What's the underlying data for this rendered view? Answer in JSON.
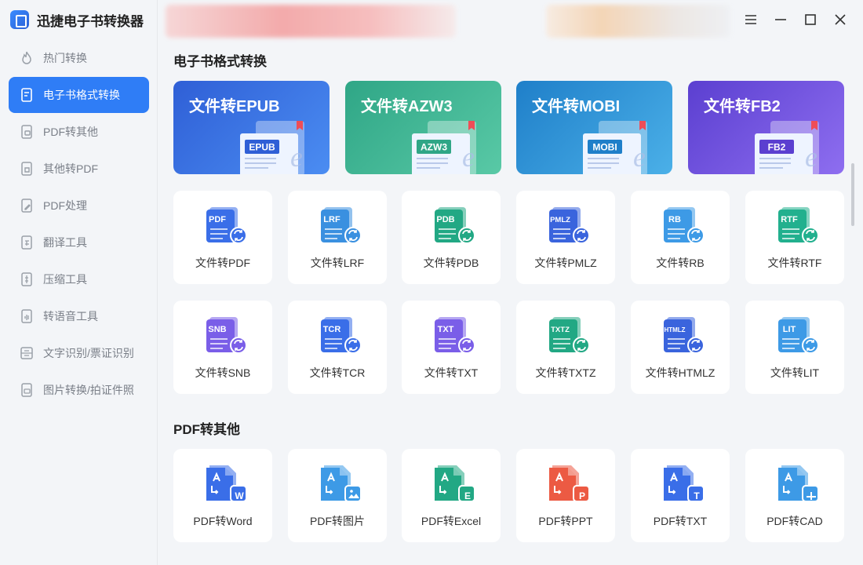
{
  "app": {
    "title": "迅捷电子书转换器"
  },
  "sidebar": {
    "items": [
      {
        "label": "热门转换",
        "icon": "flame-icon"
      },
      {
        "label": "电子书格式转换",
        "icon": "ebook-icon"
      },
      {
        "label": "PDF转其他",
        "icon": "pdf-convert-icon"
      },
      {
        "label": "其他转PDF",
        "icon": "to-pdf-icon"
      },
      {
        "label": "PDF处理",
        "icon": "pdf-edit-icon"
      },
      {
        "label": "翻译工具",
        "icon": "translate-icon"
      },
      {
        "label": "压缩工具",
        "icon": "compress-icon"
      },
      {
        "label": "转语音工具",
        "icon": "speech-icon"
      },
      {
        "label": "文字识别/票证识别",
        "icon": "ocr-icon"
      },
      {
        "label": "图片转换/拍证件照",
        "icon": "image-convert-icon"
      }
    ]
  },
  "window": {
    "menu_icon": "menu-icon",
    "minimize_icon": "minimize-icon",
    "maximize_icon": "maximize-icon",
    "close_icon": "close-icon"
  },
  "sections": {
    "ebook": {
      "title": "电子书格式转换",
      "heroes": [
        {
          "label": "文件转EPUB",
          "tag": "EPUB",
          "colors": [
            "#2f5fd6",
            "#4b8df2"
          ]
        },
        {
          "label": "文件转AZW3",
          "tag": "AZW3",
          "colors": [
            "#2fa686",
            "#59c9a6"
          ]
        },
        {
          "label": "文件转MOBI",
          "tag": "MOBI",
          "colors": [
            "#1f7fc9",
            "#4bb0e8"
          ]
        },
        {
          "label": "文件转FB2",
          "tag": "FB2",
          "colors": [
            "#5b3fd0",
            "#8e6ef0"
          ]
        }
      ],
      "tiles_row1": [
        {
          "label": "文件转PDF",
          "tag": "PDF",
          "color": "#3a6ee8"
        },
        {
          "label": "文件转LRF",
          "tag": "LRF",
          "color": "#3a90e0"
        },
        {
          "label": "文件转PDB",
          "tag": "PDB",
          "color": "#22a884"
        },
        {
          "label": "文件转PMLZ",
          "tag": "PMLZ",
          "color": "#3a64dd"
        },
        {
          "label": "文件转RB",
          "tag": "RB",
          "color": "#3d9ae6"
        },
        {
          "label": "文件转RTF",
          "tag": "RTF",
          "color": "#22b08e"
        }
      ],
      "tiles_row2": [
        {
          "label": "文件转SNB",
          "tag": "SNB",
          "color": "#7a5ee8"
        },
        {
          "label": "文件转TCR",
          "tag": "TCR",
          "color": "#3a6ee8"
        },
        {
          "label": "文件转TXT",
          "tag": "TXT",
          "color": "#7a5ee8"
        },
        {
          "label": "文件转TXTZ",
          "tag": "TXTZ",
          "color": "#22a884"
        },
        {
          "label": "文件转HTMLZ",
          "tag": "HTMLZ",
          "color": "#3a64dd"
        },
        {
          "label": "文件转LIT",
          "tag": "LIT",
          "color": "#3d9ae6"
        }
      ]
    },
    "pdf": {
      "title": "PDF转其他",
      "tiles": [
        {
          "label": "PDF转Word",
          "badge": "W",
          "color": "#3a6ee8"
        },
        {
          "label": "PDF转图片",
          "badge": "img",
          "color": "#3d9ae6"
        },
        {
          "label": "PDF转Excel",
          "badge": "E",
          "color": "#22a884"
        },
        {
          "label": "PDF转PPT",
          "badge": "P",
          "color": "#ec5a43"
        },
        {
          "label": "PDF转TXT",
          "badge": "T",
          "color": "#3a6ee8"
        },
        {
          "label": "PDF转CAD",
          "badge": "cad",
          "color": "#3d9ae6"
        }
      ]
    }
  }
}
